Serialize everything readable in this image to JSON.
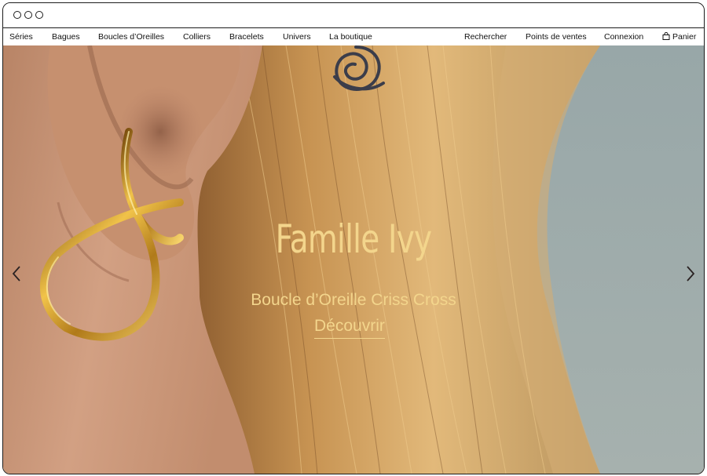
{
  "window": {
    "controls": [
      "window-dot",
      "window-dot",
      "window-dot"
    ]
  },
  "nav": {
    "left": [
      "Séries",
      "Bagues",
      "Boucles d’Oreilles",
      "Colliers",
      "Bracelets",
      "Univers",
      "La boutique"
    ],
    "right": [
      "Rechercher",
      "Points de ventes",
      "Connexion"
    ],
    "cart_label": "Panier",
    "cart_icon": "bag-icon"
  },
  "hero": {
    "title": "Famille Ivy",
    "subtitle": "Boucle d’Oreille Criss Cross",
    "cta": "Découvrir",
    "prev_icon": "chevron-left-icon",
    "next_icon": "chevron-right-icon",
    "text_color": "#f3d58c"
  }
}
